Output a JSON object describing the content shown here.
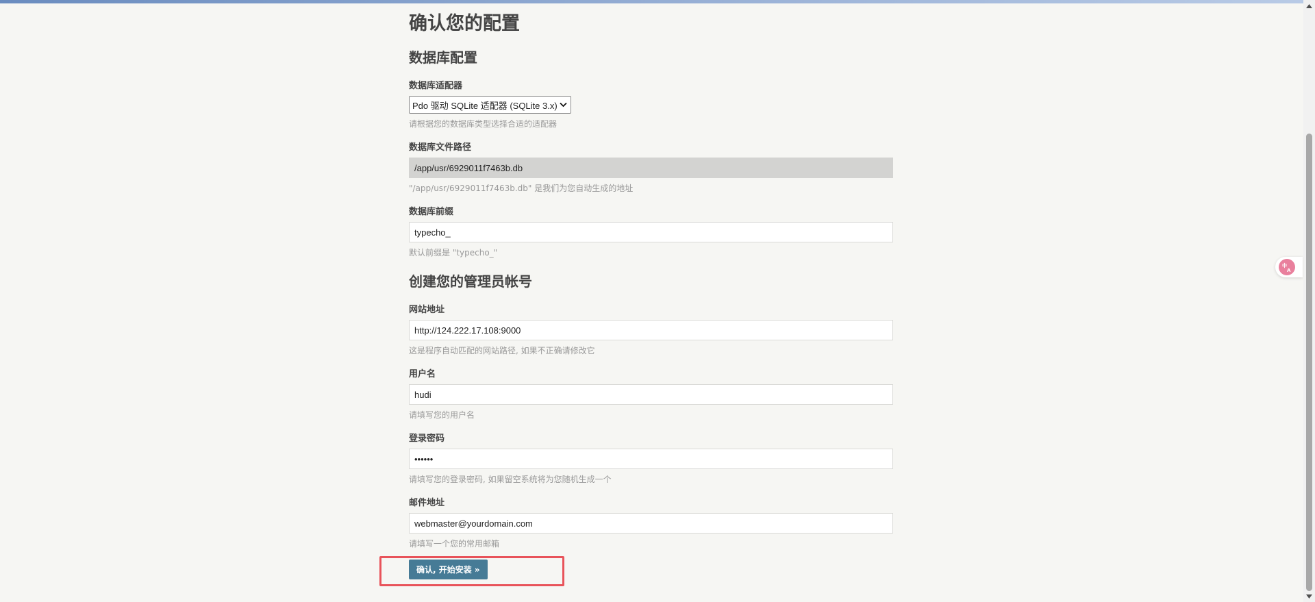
{
  "page": {
    "title": "确认您的配置"
  },
  "database": {
    "section_title": "数据库配置",
    "adapter": {
      "label": "数据库适配器",
      "selected": "Pdo 驱动 SQLite 适配器 (SQLite 3.x)",
      "hint": "请根据您的数据库类型选择合适的适配器"
    },
    "file_path": {
      "label": "数据库文件路径",
      "value": "/app/usr/6929011f7463b.db",
      "hint": "\"/app/usr/6929011f7463b.db\" 是我们为您自动生成的地址"
    },
    "prefix": {
      "label": "数据库前缀",
      "value": "typecho_",
      "hint": "默认前缀是 \"typecho_\""
    }
  },
  "admin": {
    "section_title": "创建您的管理员帐号",
    "site_url": {
      "label": "网站地址",
      "value": "http://124.222.17.108:9000",
      "hint": "这是程序自动匹配的网站路径, 如果不正确请修改它"
    },
    "username": {
      "label": "用户名",
      "value": "hudi",
      "hint": "请填写您的用户名"
    },
    "password": {
      "label": "登录密码",
      "value": "••••••",
      "hint": "请填写您的登录密码, 如果留空系统将为您随机生成一个"
    },
    "email": {
      "label": "邮件地址",
      "value": "webmaster@yourdomain.com",
      "hint": "请填写一个您的常用邮箱"
    }
  },
  "submit": {
    "label": "确认, 开始安装 »"
  },
  "colors": {
    "accent": "#467b96",
    "highlight": "#e8535a",
    "background": "#f6f6f3"
  },
  "icons": {
    "select": "chevron-down-icon",
    "scroll_up": "arrow-up-icon",
    "scroll_down": "arrow-down-icon",
    "translate": "translate-icon"
  }
}
